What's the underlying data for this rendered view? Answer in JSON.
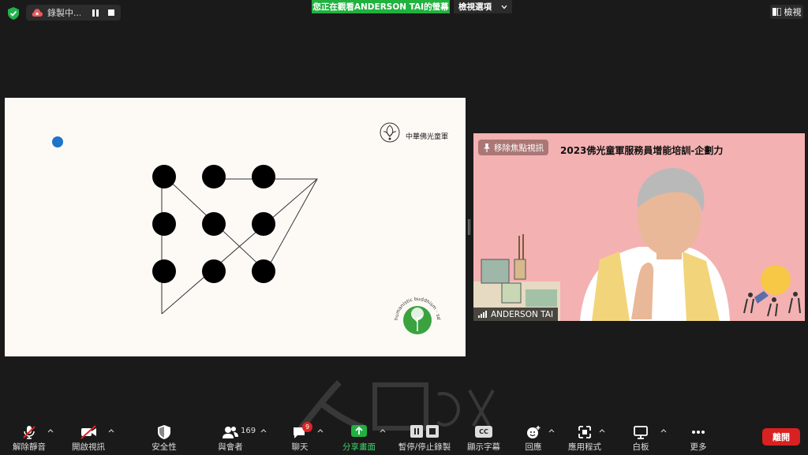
{
  "recording": {
    "label": "錄製中..."
  },
  "banner": {
    "text": "您正在觀看ANDERSON TAI的螢幕",
    "view_options": "檢視選項"
  },
  "view_button": {
    "label": "檢視"
  },
  "slide": {
    "org_name": "中華佛光童軍",
    "badge_text": "humanistic buddhism · sdgs connect · creative events",
    "puzzle": {
      "rows": 3,
      "cols": 3
    }
  },
  "video": {
    "unpin_label": "移除焦點視訊",
    "title": "2023佛光童軍服務員增能培訓-企劃力",
    "participant_name": "ANDERSON TAI"
  },
  "toolbar": {
    "unmute": "解除靜音",
    "start_video": "開啟視訊",
    "security": "安全性",
    "participants": "與會者",
    "participant_count": "169",
    "chat": "聊天",
    "chat_badge": "9",
    "share": "分享畫面",
    "record": "暫停/停止錄製",
    "captions": "顯示字幕",
    "captions_icon": "CC",
    "reactions": "回應",
    "apps": "應用程式",
    "whiteboard": "白板",
    "more": "更多",
    "leave": "離開"
  },
  "colors": {
    "share_green": "#21b13f",
    "leave_red": "#d92121",
    "slide_dot_blue": "#1f73c8",
    "video_bg": "#f4b1b1"
  }
}
